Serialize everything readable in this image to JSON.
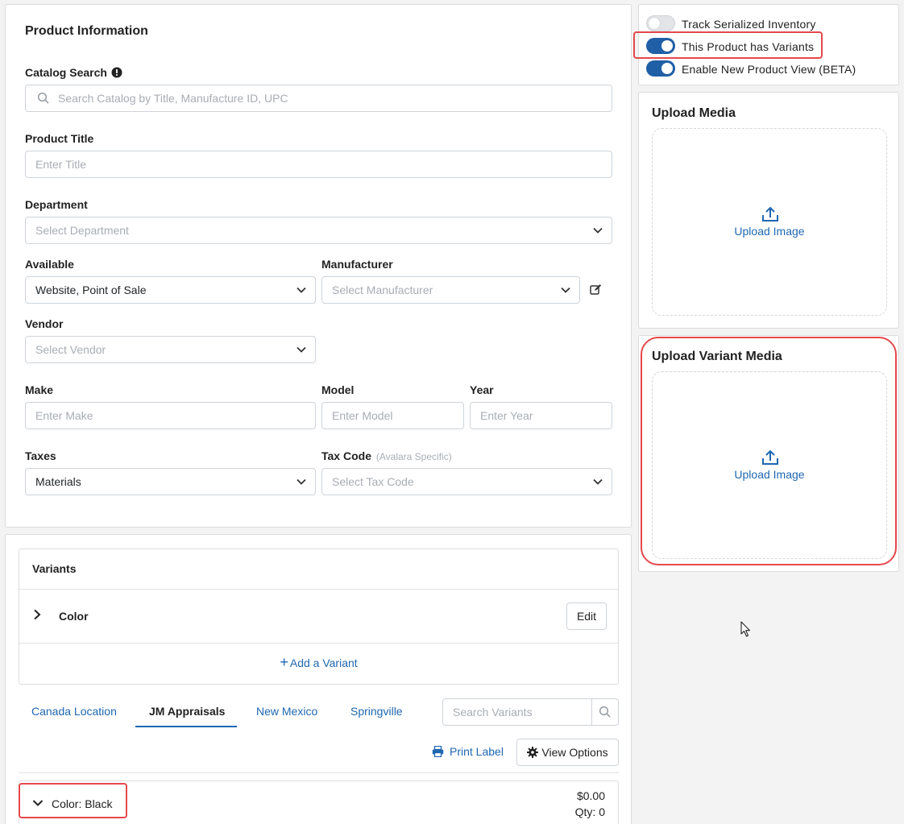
{
  "product_info": {
    "title": "Product Information",
    "catalog_search": {
      "label": "Catalog Search",
      "placeholder": "Search Catalog by Title, Manufacture ID, UPC"
    },
    "product_title": {
      "label": "Product Title",
      "placeholder": "Enter Title"
    },
    "department": {
      "label": "Department",
      "placeholder": "Select Department"
    },
    "available": {
      "label": "Available",
      "value": "Website, Point of Sale"
    },
    "manufacturer": {
      "label": "Manufacturer",
      "placeholder": "Select Manufacturer"
    },
    "vendor": {
      "label": "Vendor",
      "placeholder": "Select Vendor"
    },
    "make": {
      "label": "Make",
      "placeholder": "Enter Make"
    },
    "model": {
      "label": "Model",
      "placeholder": "Enter Model"
    },
    "year": {
      "label": "Year",
      "placeholder": "Enter Year"
    },
    "taxes": {
      "label": "Taxes",
      "value": "Materials"
    },
    "tax_code": {
      "label": "Tax Code",
      "note": "(Avalara Specific)",
      "placeholder": "Select Tax Code"
    }
  },
  "toggles": [
    {
      "label": "Track Serialized Inventory",
      "on": false
    },
    {
      "label": "This Product has Variants",
      "on": true
    },
    {
      "label": "Enable New Product View (BETA)",
      "on": true
    }
  ],
  "upload_media": {
    "title": "Upload Media",
    "link": "Upload Image"
  },
  "upload_variant_media": {
    "title": "Upload Variant Media",
    "link": "Upload Image"
  },
  "variants": {
    "header": "Variants",
    "items": [
      {
        "label": "Color",
        "edit": "Edit"
      }
    ],
    "add_label": "Add a Variant"
  },
  "locations": {
    "tabs": [
      "Canada Location",
      "JM Appraisals",
      "New Mexico",
      "Springville"
    ],
    "active_index": 1,
    "search_placeholder": "Search Variants"
  },
  "actions": {
    "print_label": "Print Label",
    "view_options": "View Options"
  },
  "variant_rows": [
    {
      "label": "Color: Black",
      "price": "$0.00",
      "qty": "Qty: 0"
    }
  ],
  "colors": {
    "accent": "#1f67b1",
    "highlight": "#e5484d",
    "toggle_on": "#1f5fa6"
  }
}
